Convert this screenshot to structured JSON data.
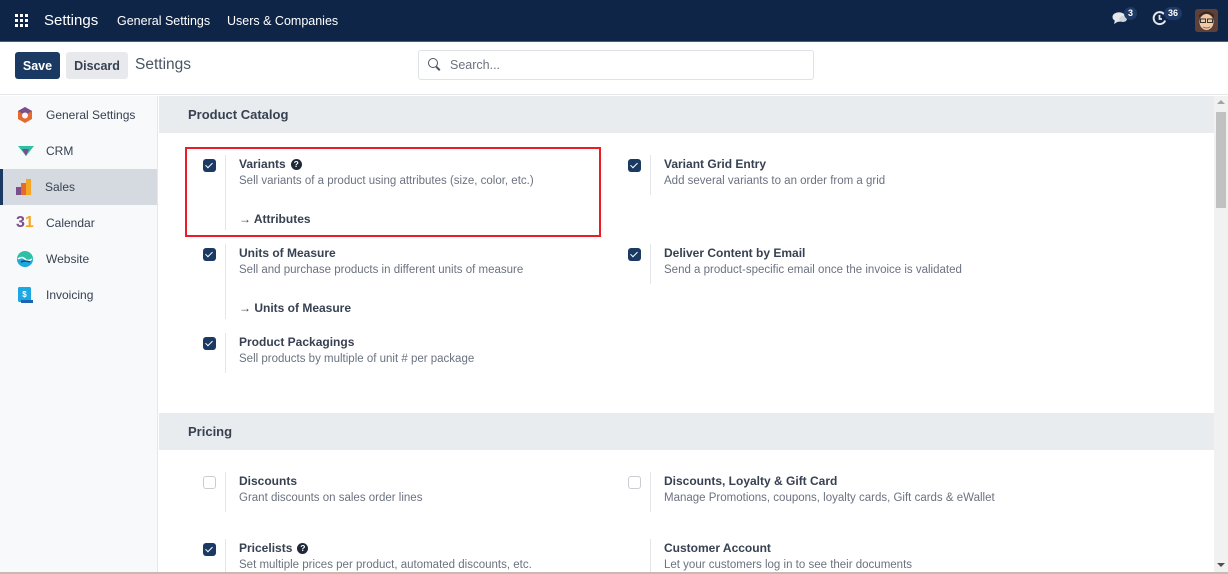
{
  "navbar": {
    "app_name": "Settings",
    "menus": [
      "General Settings",
      "Users & Companies"
    ],
    "messages_count": "3",
    "activities_count": "36"
  },
  "control_panel": {
    "save_label": "Save",
    "discard_label": "Discard",
    "title": "Settings",
    "search_placeholder": "Search..."
  },
  "sidebar": {
    "items": [
      {
        "label": "General Settings",
        "icon": "general-settings-icon",
        "active": false
      },
      {
        "label": "CRM",
        "icon": "crm-icon",
        "active": false
      },
      {
        "label": "Sales",
        "icon": "sales-icon",
        "active": true
      },
      {
        "label": "Calendar",
        "icon": "calendar-icon",
        "active": false,
        "icon_text": "31"
      },
      {
        "label": "Website",
        "icon": "website-icon",
        "active": false
      },
      {
        "label": "Invoicing",
        "icon": "invoicing-icon",
        "active": false,
        "icon_text": "$"
      }
    ]
  },
  "sections": [
    {
      "title": "Product Catalog",
      "settings": [
        {
          "title": "Variants",
          "help": true,
          "checked": true,
          "description": "Sell variants of a product using attributes (size, color, etc.)",
          "link": "Attributes",
          "highlighted": true
        },
        {
          "title": "Variant Grid Entry",
          "checked": true,
          "description": "Add several variants to an order from a grid"
        },
        {
          "title": "Units of Measure",
          "checked": true,
          "description": "Sell and purchase products in different units of measure",
          "link": "Units of Measure"
        },
        {
          "title": "Deliver Content by Email",
          "checked": true,
          "description": "Send a product-specific email once the invoice is validated"
        },
        {
          "title": "Product Packagings",
          "checked": true,
          "description": "Sell products by multiple of unit # per package"
        }
      ]
    },
    {
      "title": "Pricing",
      "settings": [
        {
          "title": "Discounts",
          "checked": false,
          "description": "Grant discounts on sales order lines"
        },
        {
          "title": "Discounts, Loyalty & Gift Card",
          "checked": false,
          "description": "Manage Promotions, coupons, loyalty cards, Gift cards & eWallet"
        },
        {
          "title": "Pricelists",
          "help": true,
          "checked": true,
          "description": "Set multiple prices per product, automated discounts, etc."
        },
        {
          "title": "Customer Account",
          "description": "Let your customers log in to see their documents"
        }
      ]
    }
  ],
  "link_arrow": "→",
  "help_glyph": "?",
  "colors": {
    "navbar": "#0f2548",
    "primary": "#1b3a63",
    "highlight_box": "#ec1c24"
  }
}
